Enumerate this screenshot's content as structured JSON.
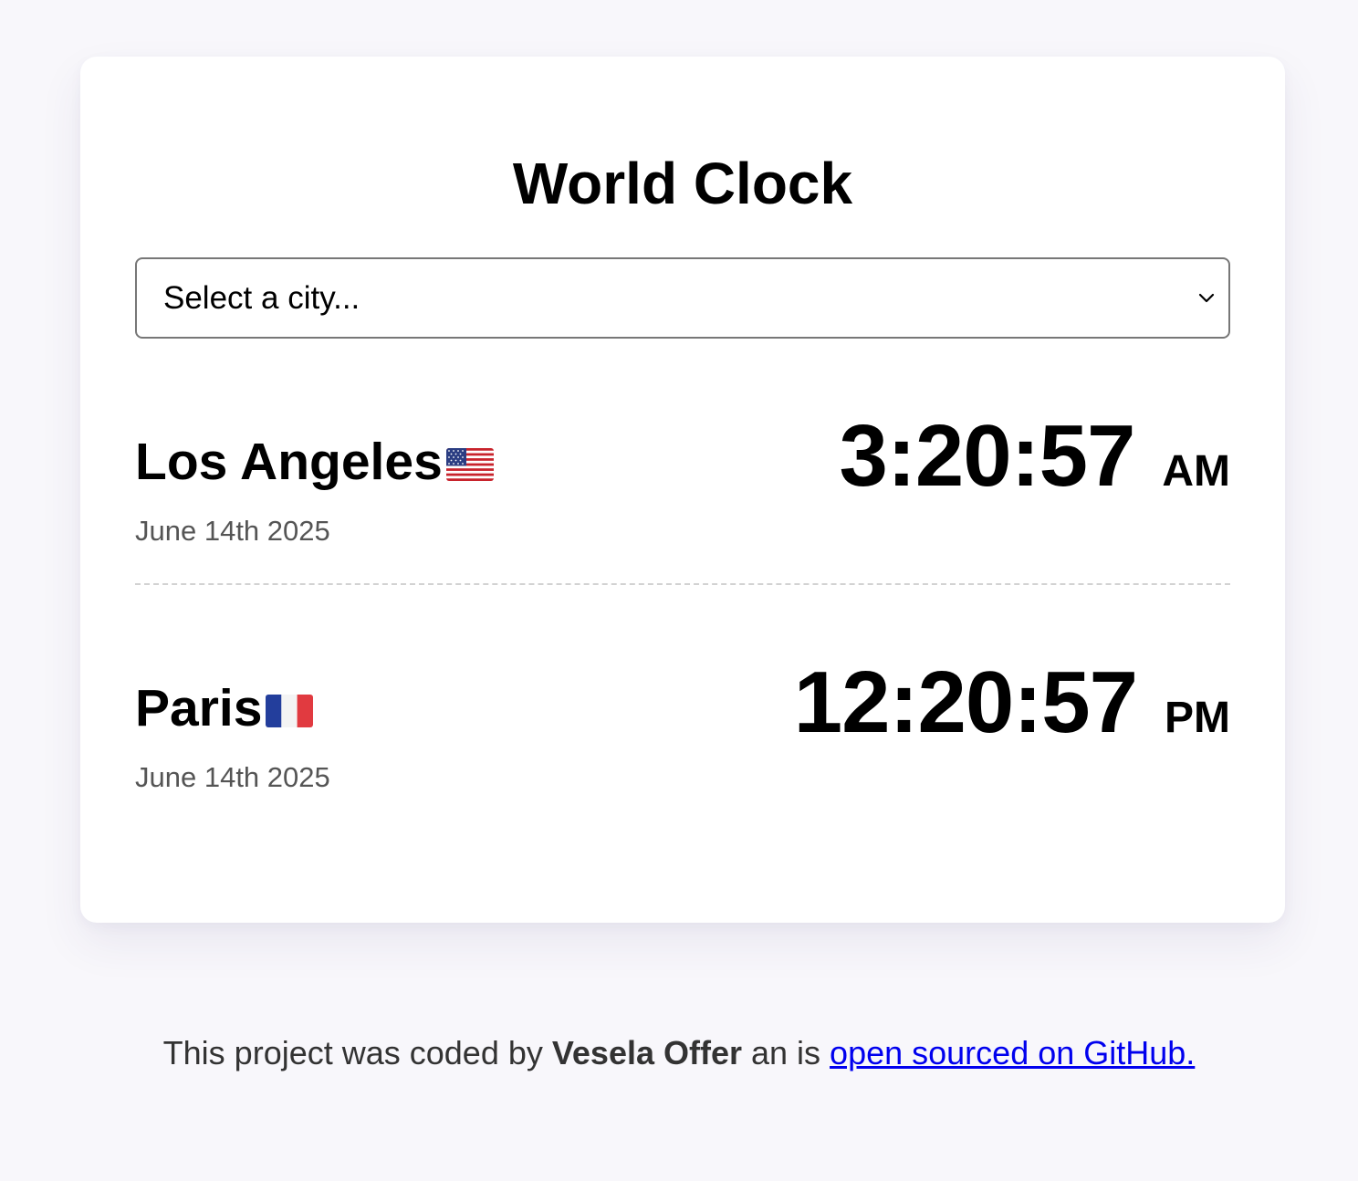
{
  "app": {
    "title": "World Clock"
  },
  "city_select": {
    "placeholder": "Select a city..."
  },
  "cities": [
    {
      "name": "Los Angeles",
      "flag": "us-flag",
      "date": "June 14th 2025",
      "time": "3:20:57",
      "ampm": "AM"
    },
    {
      "name": "Paris",
      "flag": "fr-flag",
      "date": "June 14th 2025",
      "time": "12:20:57",
      "ampm": "PM"
    }
  ],
  "footer": {
    "prefix": "This project was coded by ",
    "author": "Vesela Offer",
    "middle": " an is ",
    "link_text": "open sourced on GitHub."
  },
  "colors": {
    "page_background": "#f8f7fb",
    "card_background": "#ffffff",
    "link": "#0000ee",
    "date_text": "#555555",
    "divider": "#d2d2d2"
  }
}
